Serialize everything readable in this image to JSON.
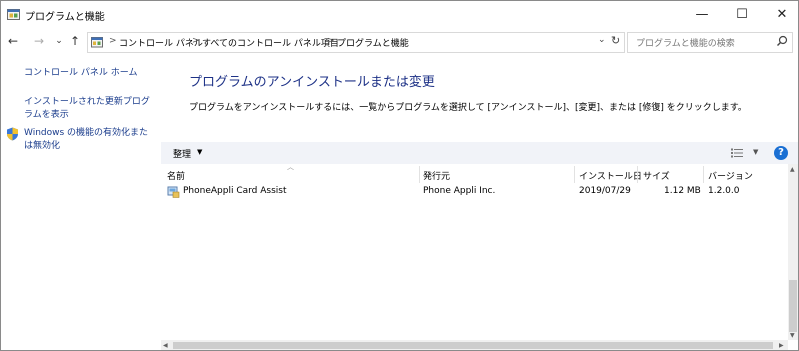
{
  "window": {
    "title": "プログラムと機能",
    "controls": {
      "minimize": "—",
      "maximize": "☐",
      "close": "✕"
    }
  },
  "navigation": {
    "breadcrumb": [
      "コントロール パネル",
      "すべてのコントロール パネル項目",
      "プログラムと機能"
    ],
    "separator": ">",
    "search_placeholder": "プログラムと機能の検索"
  },
  "sidebar": {
    "items": [
      {
        "label": "コントロール パネル ホーム",
        "icon": ""
      },
      {
        "label": "インストールされた更新プログラムを表示",
        "icon": ""
      },
      {
        "label": "Windows の機能の有効化または無効化",
        "icon": "shield-icon"
      }
    ]
  },
  "main": {
    "heading": "プログラムのアンインストールまたは変更",
    "description": "プログラムをアンインストールするには、一覧からプログラムを選択して [アンインストール]、[変更]、または [修復] をクリックします。"
  },
  "toolbar": {
    "organize_label": "整理",
    "help": "?"
  },
  "table": {
    "columns": [
      "名前",
      "発行元",
      "インストール日",
      "サイズ",
      "バージョン"
    ],
    "rows": [
      {
        "name": "PhoneAppli Card Assist",
        "publisher": "Phone Appli Inc.",
        "installed": "2019/07/29",
        "size": "1.12 MB",
        "version": "1.2.0.0"
      }
    ]
  },
  "colors": {
    "heading": "#1e3287",
    "link": "#1a3c8c",
    "toolbar_bg": "#f1f3f8",
    "help_icon": "#1a6fd3"
  }
}
